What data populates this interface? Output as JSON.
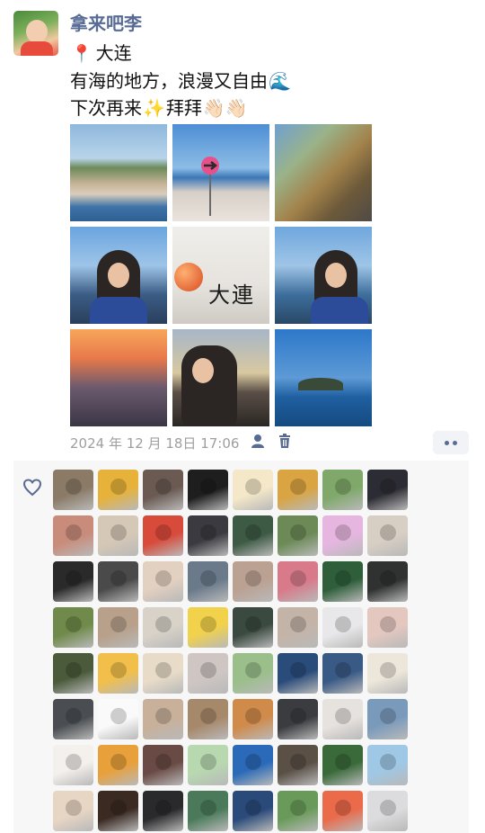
{
  "post": {
    "author": "拿来吧李",
    "lines": [
      {
        "emoji_before": "📍",
        "text": "大连",
        "emoji_after": ""
      },
      {
        "emoji_before": "",
        "text": "有海的地方，浪漫又自由",
        "emoji_after": "🌊"
      },
      {
        "emoji_before": "",
        "text": "下次再来",
        "emoji_after": "✨"
      }
    ],
    "line3_tail": "拜拜",
    "line3_tail_emoji": "👋🏻👋🏻",
    "photo_sign_text": "大連",
    "timestamp": "2024 年 12 月 18日 17:06",
    "icons": {
      "location": "pin-icon",
      "privacy": "person-icon",
      "delete": "trash-icon",
      "more": "more-dots-icon",
      "like": "heart-outline-icon"
    }
  },
  "photos": [
    {
      "name": "photo-coastal-town"
    },
    {
      "name": "photo-arrow-sign-sea"
    },
    {
      "name": "photo-castle-coast"
    },
    {
      "name": "photo-girl-blue-scarf-sea"
    },
    {
      "name": "photo-dalian-wall-sign"
    },
    {
      "name": "photo-girl-sea-blue"
    },
    {
      "name": "photo-sunset-pier"
    },
    {
      "name": "photo-girl-selfie-sunset"
    },
    {
      "name": "photo-island-blue-sea"
    }
  ],
  "likes": {
    "count_rows": 8,
    "avatars": [
      "#8a7a66",
      "#e6b23a",
      "#6a5a52",
      "#1e1e1e",
      "#f4e8c8",
      "#d9a441",
      "#7fa86a",
      "#2c2c34",
      "#c98b7a",
      "#d6c8b6",
      "#d84a3a",
      "#3a3a40",
      "#3d5a44",
      "#6c8a56",
      "#e6b6e0",
      "#d8cfc4",
      "#2a2a2a",
      "#4a4a4a",
      "#e2d0c0",
      "#6a7a8a",
      "#bba192",
      "#d87a8a",
      "#2e5e3a",
      "#2f3230",
      "#6f8a4a",
      "#b8a08a",
      "#d8d2c8",
      "#f2d24a",
      "#3a4a40",
      "#c4b4a8",
      "#e8e8ea",
      "#e4c8c0",
      "#4a5a3a",
      "#f2c04a",
      "#e8dcc8",
      "#cfc6c4",
      "#9abf8a",
      "#2a4c7a",
      "#3a5a86",
      "#ede6da",
      "#4a4e52",
      "#fafafa",
      "#c8b09a",
      "#a6886a",
      "#d08a4a",
      "#3a3c40",
      "#e6e2de",
      "#7a9abc",
      "#f4f0ec",
      "#e8a03a",
      "#6a4a44",
      "#b8d8b0",
      "#2a6ab8",
      "#5a5046",
      "#3a6a3a",
      "#9ec8e6",
      "#e8d6c4",
      "#3a2a22",
      "#2a2a2c",
      "#4a7a5a",
      "#2a4a7a",
      "#6a9a5a",
      "#ea6a4a",
      "#dcdcde"
    ]
  }
}
